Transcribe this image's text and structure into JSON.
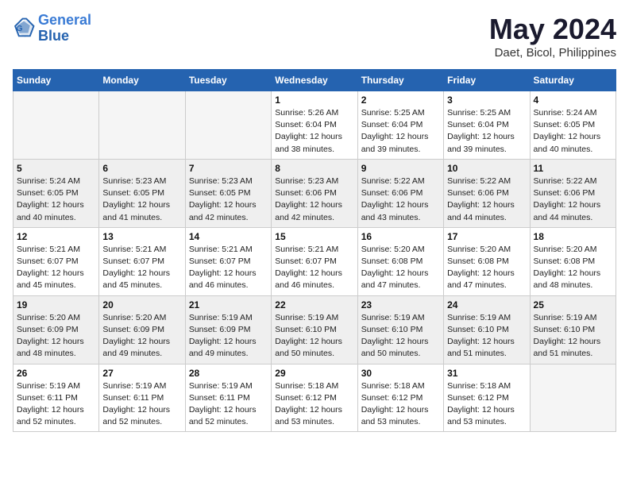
{
  "header": {
    "logo_line1": "General",
    "logo_line2": "Blue",
    "title": "May 2024",
    "location": "Daet, Bicol, Philippines"
  },
  "weekdays": [
    "Sunday",
    "Monday",
    "Tuesday",
    "Wednesday",
    "Thursday",
    "Friday",
    "Saturday"
  ],
  "weeks": [
    {
      "shaded": false,
      "days": [
        {
          "num": "",
          "info": ""
        },
        {
          "num": "",
          "info": ""
        },
        {
          "num": "",
          "info": ""
        },
        {
          "num": "1",
          "info": "Sunrise: 5:26 AM\nSunset: 6:04 PM\nDaylight: 12 hours\nand 38 minutes."
        },
        {
          "num": "2",
          "info": "Sunrise: 5:25 AM\nSunset: 6:04 PM\nDaylight: 12 hours\nand 39 minutes."
        },
        {
          "num": "3",
          "info": "Sunrise: 5:25 AM\nSunset: 6:04 PM\nDaylight: 12 hours\nand 39 minutes."
        },
        {
          "num": "4",
          "info": "Sunrise: 5:24 AM\nSunset: 6:05 PM\nDaylight: 12 hours\nand 40 minutes."
        }
      ]
    },
    {
      "shaded": true,
      "days": [
        {
          "num": "5",
          "info": "Sunrise: 5:24 AM\nSunset: 6:05 PM\nDaylight: 12 hours\nand 40 minutes."
        },
        {
          "num": "6",
          "info": "Sunrise: 5:23 AM\nSunset: 6:05 PM\nDaylight: 12 hours\nand 41 minutes."
        },
        {
          "num": "7",
          "info": "Sunrise: 5:23 AM\nSunset: 6:05 PM\nDaylight: 12 hours\nand 42 minutes."
        },
        {
          "num": "8",
          "info": "Sunrise: 5:23 AM\nSunset: 6:06 PM\nDaylight: 12 hours\nand 42 minutes."
        },
        {
          "num": "9",
          "info": "Sunrise: 5:22 AM\nSunset: 6:06 PM\nDaylight: 12 hours\nand 43 minutes."
        },
        {
          "num": "10",
          "info": "Sunrise: 5:22 AM\nSunset: 6:06 PM\nDaylight: 12 hours\nand 44 minutes."
        },
        {
          "num": "11",
          "info": "Sunrise: 5:22 AM\nSunset: 6:06 PM\nDaylight: 12 hours\nand 44 minutes."
        }
      ]
    },
    {
      "shaded": false,
      "days": [
        {
          "num": "12",
          "info": "Sunrise: 5:21 AM\nSunset: 6:07 PM\nDaylight: 12 hours\nand 45 minutes."
        },
        {
          "num": "13",
          "info": "Sunrise: 5:21 AM\nSunset: 6:07 PM\nDaylight: 12 hours\nand 45 minutes."
        },
        {
          "num": "14",
          "info": "Sunrise: 5:21 AM\nSunset: 6:07 PM\nDaylight: 12 hours\nand 46 minutes."
        },
        {
          "num": "15",
          "info": "Sunrise: 5:21 AM\nSunset: 6:07 PM\nDaylight: 12 hours\nand 46 minutes."
        },
        {
          "num": "16",
          "info": "Sunrise: 5:20 AM\nSunset: 6:08 PM\nDaylight: 12 hours\nand 47 minutes."
        },
        {
          "num": "17",
          "info": "Sunrise: 5:20 AM\nSunset: 6:08 PM\nDaylight: 12 hours\nand 47 minutes."
        },
        {
          "num": "18",
          "info": "Sunrise: 5:20 AM\nSunset: 6:08 PM\nDaylight: 12 hours\nand 48 minutes."
        }
      ]
    },
    {
      "shaded": true,
      "days": [
        {
          "num": "19",
          "info": "Sunrise: 5:20 AM\nSunset: 6:09 PM\nDaylight: 12 hours\nand 48 minutes."
        },
        {
          "num": "20",
          "info": "Sunrise: 5:20 AM\nSunset: 6:09 PM\nDaylight: 12 hours\nand 49 minutes."
        },
        {
          "num": "21",
          "info": "Sunrise: 5:19 AM\nSunset: 6:09 PM\nDaylight: 12 hours\nand 49 minutes."
        },
        {
          "num": "22",
          "info": "Sunrise: 5:19 AM\nSunset: 6:10 PM\nDaylight: 12 hours\nand 50 minutes."
        },
        {
          "num": "23",
          "info": "Sunrise: 5:19 AM\nSunset: 6:10 PM\nDaylight: 12 hours\nand 50 minutes."
        },
        {
          "num": "24",
          "info": "Sunrise: 5:19 AM\nSunset: 6:10 PM\nDaylight: 12 hours\nand 51 minutes."
        },
        {
          "num": "25",
          "info": "Sunrise: 5:19 AM\nSunset: 6:10 PM\nDaylight: 12 hours\nand 51 minutes."
        }
      ]
    },
    {
      "shaded": false,
      "days": [
        {
          "num": "26",
          "info": "Sunrise: 5:19 AM\nSunset: 6:11 PM\nDaylight: 12 hours\nand 52 minutes."
        },
        {
          "num": "27",
          "info": "Sunrise: 5:19 AM\nSunset: 6:11 PM\nDaylight: 12 hours\nand 52 minutes."
        },
        {
          "num": "28",
          "info": "Sunrise: 5:19 AM\nSunset: 6:11 PM\nDaylight: 12 hours\nand 52 minutes."
        },
        {
          "num": "29",
          "info": "Sunrise: 5:18 AM\nSunset: 6:12 PM\nDaylight: 12 hours\nand 53 minutes."
        },
        {
          "num": "30",
          "info": "Sunrise: 5:18 AM\nSunset: 6:12 PM\nDaylight: 12 hours\nand 53 minutes."
        },
        {
          "num": "31",
          "info": "Sunrise: 5:18 AM\nSunset: 6:12 PM\nDaylight: 12 hours\nand 53 minutes."
        },
        {
          "num": "",
          "info": ""
        }
      ]
    }
  ]
}
